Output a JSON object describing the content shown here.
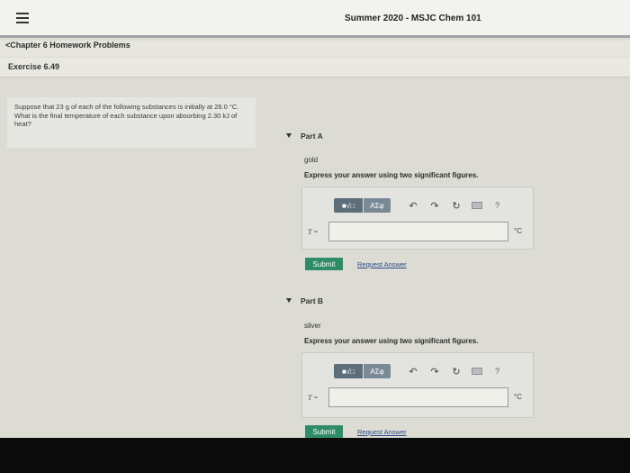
{
  "header": {
    "menu_icon": "hamburger-menu-icon",
    "title": "Summer 2020 - MSJC Chem 101"
  },
  "breadcrumb": {
    "back_label": "<Chapter 6 Homework Problems"
  },
  "exercise": {
    "title": "Exercise 6.49"
  },
  "question": {
    "text": "Suppose that 23 g of each of the following substances is initially at 26.0 °C. What is the final temperature of each substance upon absorbing 2.30 kJ of heat?"
  },
  "toolbar": {
    "templates_label": "■√□",
    "greek_label": "ΑΣφ",
    "icons": [
      "undo-icon",
      "redo-icon",
      "reset-icon",
      "keyboard-icon",
      "help-icon"
    ],
    "help_label": "?"
  },
  "parts": [
    {
      "header": "Part A",
      "substance": "gold",
      "instructions": "Express your answer using two significant figures.",
      "variable": "T =",
      "value": "",
      "unit": "°C",
      "submit_label": "Submit",
      "request_label": "Request Answer"
    },
    {
      "header": "Part B",
      "substance": "silver",
      "instructions": "Express your answer using two significant figures.",
      "variable": "T =",
      "value": "",
      "unit": "°C",
      "submit_label": "Submit",
      "request_label": "Request Answer"
    }
  ],
  "colors": {
    "submit": "#2e8d68",
    "toolbar": "#5d6d7a",
    "link": "#2b4a88"
  }
}
